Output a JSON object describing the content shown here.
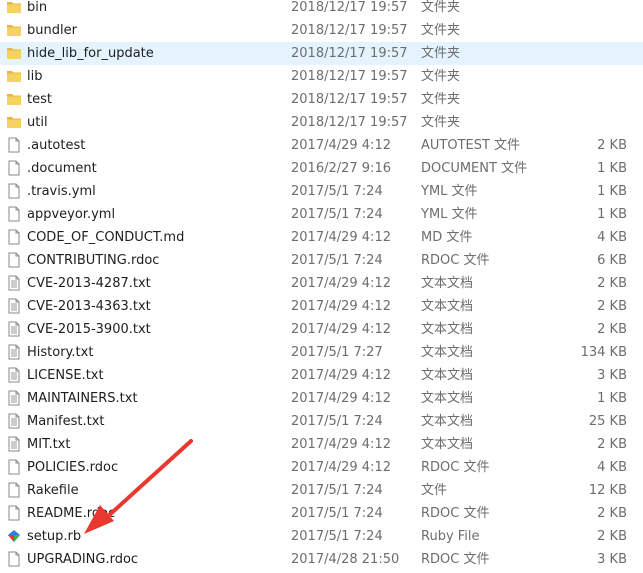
{
  "colors": {
    "selected_row_bg": "#e5f3ff",
    "folder_yellow": "#f2c94c",
    "arrow_red": "#e8382f"
  },
  "files": [
    {
      "name": "bin",
      "date": "2018/12/17 19:57",
      "type": "文件夹",
      "size": "",
      "icon": "folder-icon"
    },
    {
      "name": "bundler",
      "date": "2018/12/17 19:57",
      "type": "文件夹",
      "size": "",
      "icon": "folder-icon"
    },
    {
      "name": "hide_lib_for_update",
      "date": "2018/12/17 19:57",
      "type": "文件夹",
      "size": "",
      "icon": "folder-icon",
      "selected": true
    },
    {
      "name": "lib",
      "date": "2018/12/17 19:57",
      "type": "文件夹",
      "size": "",
      "icon": "folder-icon"
    },
    {
      "name": "test",
      "date": "2018/12/17 19:57",
      "type": "文件夹",
      "size": "",
      "icon": "folder-icon"
    },
    {
      "name": "util",
      "date": "2018/12/17 19:57",
      "type": "文件夹",
      "size": "",
      "icon": "folder-icon"
    },
    {
      "name": ".autotest",
      "date": "2017/4/29 4:12",
      "type": "AUTOTEST 文件",
      "size": "2 KB",
      "icon": "file-icon"
    },
    {
      "name": ".document",
      "date": "2016/2/27 9:16",
      "type": "DOCUMENT 文件",
      "size": "1 KB",
      "icon": "file-icon"
    },
    {
      "name": ".travis.yml",
      "date": "2017/5/1 7:24",
      "type": "YML 文件",
      "size": "1 KB",
      "icon": "file-icon"
    },
    {
      "name": "appveyor.yml",
      "date": "2017/5/1 7:24",
      "type": "YML 文件",
      "size": "1 KB",
      "icon": "file-icon"
    },
    {
      "name": "CODE_OF_CONDUCT.md",
      "date": "2017/4/29 4:12",
      "type": "MD 文件",
      "size": "4 KB",
      "icon": "file-icon"
    },
    {
      "name": "CONTRIBUTING.rdoc",
      "date": "2017/5/1 7:24",
      "type": "RDOC 文件",
      "size": "6 KB",
      "icon": "file-icon"
    },
    {
      "name": "CVE-2013-4287.txt",
      "date": "2017/4/29 4:12",
      "type": "文本文档",
      "size": "2 KB",
      "icon": "text-file-icon"
    },
    {
      "name": "CVE-2013-4363.txt",
      "date": "2017/4/29 4:12",
      "type": "文本文档",
      "size": "2 KB",
      "icon": "text-file-icon"
    },
    {
      "name": "CVE-2015-3900.txt",
      "date": "2017/4/29 4:12",
      "type": "文本文档",
      "size": "2 KB",
      "icon": "text-file-icon"
    },
    {
      "name": "History.txt",
      "date": "2017/5/1 7:27",
      "type": "文本文档",
      "size": "134 KB",
      "icon": "text-file-icon"
    },
    {
      "name": "LICENSE.txt",
      "date": "2017/4/29 4:12",
      "type": "文本文档",
      "size": "3 KB",
      "icon": "text-file-icon"
    },
    {
      "name": "MAINTAINERS.txt",
      "date": "2017/4/29 4:12",
      "type": "文本文档",
      "size": "1 KB",
      "icon": "text-file-icon"
    },
    {
      "name": "Manifest.txt",
      "date": "2017/5/1 7:24",
      "type": "文本文档",
      "size": "25 KB",
      "icon": "text-file-icon"
    },
    {
      "name": "MIT.txt",
      "date": "2017/4/29 4:12",
      "type": "文本文档",
      "size": "2 KB",
      "icon": "text-file-icon"
    },
    {
      "name": "POLICIES.rdoc",
      "date": "2017/4/29 4:12",
      "type": "RDOC 文件",
      "size": "4 KB",
      "icon": "file-icon"
    },
    {
      "name": "Rakefile",
      "date": "2017/5/1 7:24",
      "type": "文件",
      "size": "12 KB",
      "icon": "file-icon"
    },
    {
      "name": "README.rdoc",
      "date": "2017/5/1 7:24",
      "type": "RDOC 文件",
      "size": "2 KB",
      "icon": "file-icon"
    },
    {
      "name": "setup.rb",
      "date": "2017/5/1 7:24",
      "type": "Ruby File",
      "size": "2 KB",
      "icon": "ruby-file-icon"
    },
    {
      "name": "UPGRADING.rdoc",
      "date": "2017/4/28 21:50",
      "type": "RDOC 文件",
      "size": "3 KB",
      "icon": "file-icon"
    }
  ]
}
